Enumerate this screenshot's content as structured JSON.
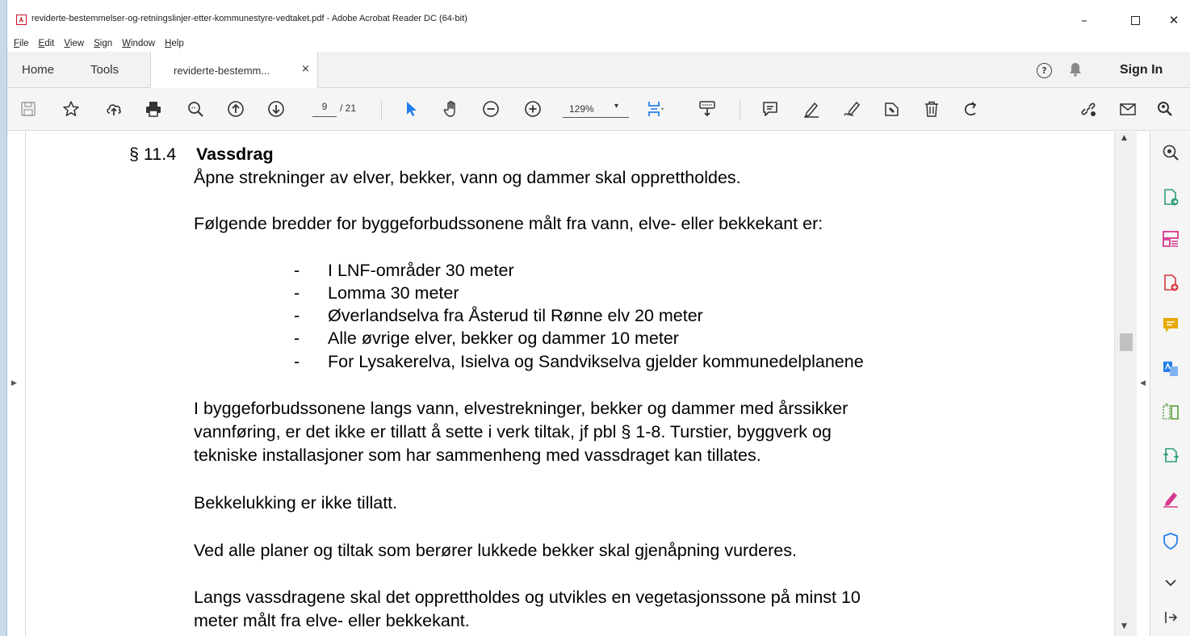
{
  "window": {
    "title": "reviderte-bestemmelser-og-retningslinjer-etter-kommunestyre-vedtaket.pdf - Adobe Acrobat Reader DC (64-bit)",
    "minimize": "–",
    "close": "✕"
  },
  "menu": {
    "items": [
      {
        "u": "F",
        "rest": "ile"
      },
      {
        "u": "E",
        "rest": "dit"
      },
      {
        "u": "V",
        "rest": "iew"
      },
      {
        "u": "S",
        "rest": "ign"
      },
      {
        "u": "W",
        "rest": "indow"
      },
      {
        "u": "H",
        "rest": "elp"
      }
    ]
  },
  "tabs": {
    "home": "Home",
    "tools": "Tools",
    "document": "reviderte-bestemm...",
    "close": "×",
    "help": "?",
    "signin": "Sign In"
  },
  "toolbar": {
    "page_current": "9",
    "page_total": "/ 21",
    "zoom": "129%",
    "zoom_caret": "▾"
  },
  "document": {
    "section_number": "§ 11.4",
    "section_title": "Vassdrag",
    "p1": "Åpne strekninger av elver, bekker, vann og dammer skal opprettholdes.",
    "p2": "Følgende bredder for byggeforbudssonene målt fra vann, elve- eller bekkekant er:",
    "list_dash": "-",
    "list": [
      "I LNF-områder 30 meter",
      "Lomma 30 meter",
      "Øverlandselva fra Åsterud til Rønne elv 20 meter",
      "Alle øvrige elver, bekker og dammer 10 meter",
      "For Lysakerelva, Isielva og Sandvikselva gjelder kommunedelplanene"
    ],
    "p3_lines": [
      "I byggeforbudssonene langs vann, elvestrekninger, bekker og dammer med årssikker",
      "vannføring, er det ikke er tillatt å sette i verk tiltak, jf pbl § 1-8. Turstier, byggverk og",
      "tekniske installasjoner som har sammenheng med vassdraget kan tillates."
    ],
    "p4": "Bekkelukking er ikke tillatt.",
    "p5": "Ved alle planer og tiltak som berører lukkede bekker skal gjenåpning vurderes.",
    "p6_lines": [
      "Langs vassdragene skal det opprettholdes og utvikles en vegetasjonssone på minst 10",
      "meter målt fra elve- eller bekkekant."
    ]
  },
  "colors": {
    "accent": "#2680eb",
    "acrobat_red": "#c8102e",
    "tool_green": "#2d9d78",
    "tool_yellow": "#e6a800",
    "tool_pink": "#d83790",
    "tool_blue": "#2680eb"
  }
}
